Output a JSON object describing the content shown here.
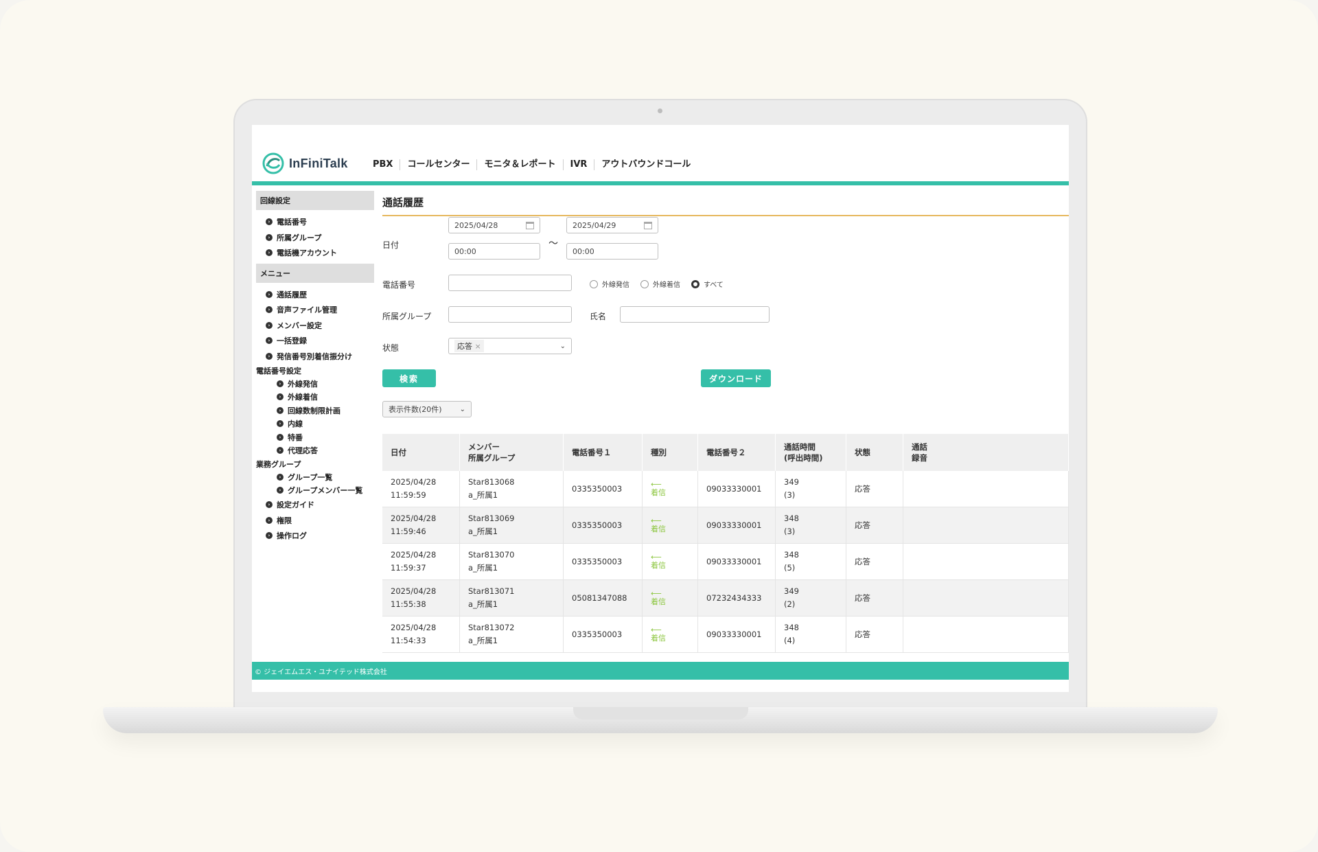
{
  "app": {
    "name": "InFiniTalk"
  },
  "nav": [
    "PBX",
    "コールセンター",
    "モニタ＆レポート",
    "IVR",
    "アウトバウンドコール"
  ],
  "sidebar": {
    "section1": "回線設定",
    "section1_items": [
      "電話番号",
      "所属グループ",
      "電話機アカウント"
    ],
    "section2": "メニュー",
    "section2_items": [
      "通話履歴",
      "音声ファイル管理",
      "メンバー設定",
      "一括登録",
      "発信番号別着信振分け"
    ],
    "group1": "電話番号設定",
    "group1_items": [
      "外線発信",
      "外線着信",
      "回線数制限計画",
      "内線",
      "特番",
      "代理応答"
    ],
    "group2": "業務グループ",
    "group2_items": [
      "グループ一覧",
      "グループメンバー一覧"
    ],
    "tail_items": [
      "設定ガイド",
      "権限",
      "操作ログ"
    ]
  },
  "page": {
    "title": "通話履歴"
  },
  "filters": {
    "date_label": "日付",
    "date_from": "2025/04/28",
    "date_to": "2025/04/29",
    "time_from": "00:00",
    "time_to": "00:00",
    "tilde": "～",
    "phone_label": "電話番号",
    "radio_out": "外線発信",
    "radio_in": "外線着信",
    "radio_all": "すべて",
    "group_label": "所属グループ",
    "name_label": "氏名",
    "status_label": "状態",
    "status_chip": "応答",
    "search_btn": "検索",
    "download_btn": "ダウンロード",
    "page_size": "表示件数(20件)"
  },
  "table": {
    "headers": {
      "date": "日付",
      "member1": "メンバー",
      "member2": "所属グループ",
      "phone1": "電話番号１",
      "type": "種別",
      "phone2": "電話番号２",
      "duration1": "通話時間",
      "duration2": "(呼出時間)",
      "status": "状態",
      "rec1": "通話",
      "rec2": "録音"
    },
    "rows": [
      {
        "date": "2025/04/28",
        "time": "11:59:59",
        "member": "Star813068",
        "group": "a_所属1",
        "phone1": "0335350003",
        "type": "着信",
        "phone2": "09033330001",
        "dur": "349",
        "ring": "(3)",
        "status": "応答"
      },
      {
        "date": "2025/04/28",
        "time": "11:59:46",
        "member": "Star813069",
        "group": "a_所属1",
        "phone1": "0335350003",
        "type": "着信",
        "phone2": "09033330001",
        "dur": "348",
        "ring": "(3)",
        "status": "応答"
      },
      {
        "date": "2025/04/28",
        "time": "11:59:37",
        "member": "Star813070",
        "group": "a_所属1",
        "phone1": "0335350003",
        "type": "着信",
        "phone2": "09033330001",
        "dur": "348",
        "ring": "(5)",
        "status": "応答"
      },
      {
        "date": "2025/04/28",
        "time": "11:55:38",
        "member": "Star813071",
        "group": "a_所属1",
        "phone1": "05081347088",
        "type": "着信",
        "phone2": "07232434333",
        "dur": "349",
        "ring": "(2)",
        "status": "応答"
      },
      {
        "date": "2025/04/28",
        "time": "11:54:33",
        "member": "Star813072",
        "group": "a_所属1",
        "phone1": "0335350003",
        "type": "着信",
        "phone2": "09033330001",
        "dur": "348",
        "ring": "(4)",
        "status": "応答"
      }
    ]
  },
  "footer": "© ジェイエムエス・ユナイテッド株式会社",
  "colors": {
    "accent": "#35bfa8",
    "title_underline": "#e6b85e",
    "incoming_arrow": "#8cc63f"
  }
}
